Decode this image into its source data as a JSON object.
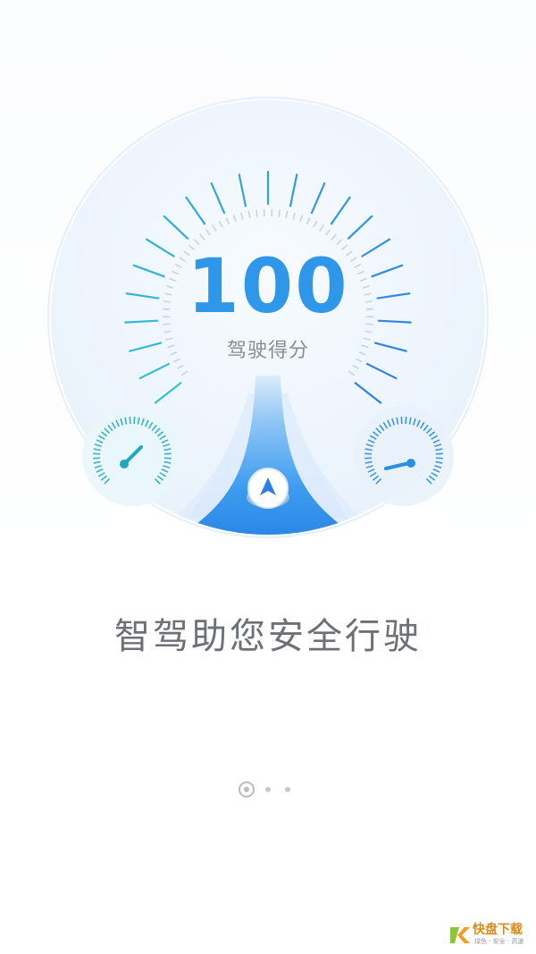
{
  "score": {
    "value": "100",
    "label": "驾驶得分"
  },
  "slogan": "智驾助您安全行驶",
  "pager": {
    "total": 3,
    "active_index": 0
  },
  "icons": {
    "center": "navigation-arrow-icon",
    "left_gauge": "gauge-icon",
    "right_gauge": "gauge-icon"
  },
  "colors": {
    "accent": "#2f97ea",
    "tick_teal": "#33c2cf",
    "disc": "#eef5fd",
    "text_gray": "#6d7177"
  },
  "watermark": {
    "brand": "快盘下载",
    "logo_char": "快",
    "tagline": "绿色 · 安全 · 高速"
  }
}
